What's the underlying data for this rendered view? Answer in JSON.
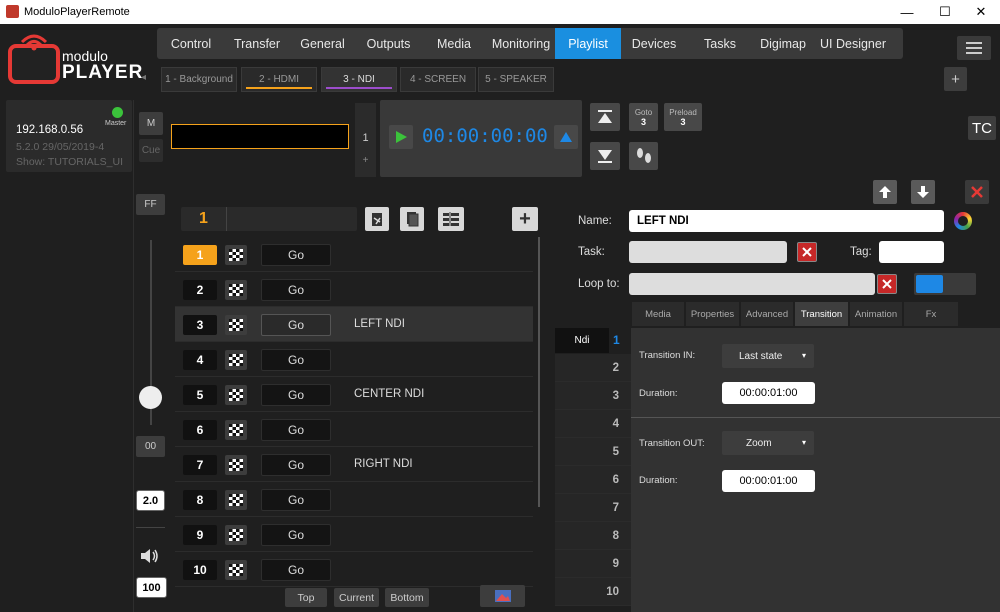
{
  "window": {
    "title": "ModuloPlayerRemote",
    "minimize": "—",
    "maximize": "☐",
    "close": "✕"
  },
  "logo": {
    "brand_top": "modulo",
    "brand_bottom": "PLAYER"
  },
  "nav": {
    "items": [
      "Control",
      "Transfer",
      "General",
      "Outputs",
      "Media",
      "Monitoring",
      "Playlist",
      "Devices",
      "Tasks",
      "Digimap",
      "UI Designer"
    ],
    "active": "Playlist"
  },
  "layer_tabs": {
    "items": [
      "1 - Background",
      "2 - HDMI",
      "3 - NDI",
      "4 - SCREEN",
      "5 - SPEAKER"
    ],
    "active": "3 - NDI",
    "add_label": "+",
    "left_arrow": "◂"
  },
  "server": {
    "ip": "192.168.0.56",
    "status": "Master",
    "version": "5.2.0 29/05/2019-4",
    "show": "Show: TUTORIALS_UI"
  },
  "left": {
    "m_label": "M",
    "cue_label": "Cue",
    "ff_label": "FF",
    "zero_label": "00",
    "speed_value": "2.0",
    "volume_value": "100"
  },
  "transport": {
    "cue_index": "1",
    "plus": "+",
    "timecode": "00:00:00:00"
  },
  "goto": {
    "label": "Goto",
    "value": "3"
  },
  "preload": {
    "label": "Preload",
    "value": "3"
  },
  "tc_label": "TC",
  "playlist": {
    "current_cue": "1",
    "add_label": "+",
    "rows": [
      {
        "num": "1",
        "go": "Go",
        "label": ""
      },
      {
        "num": "2",
        "go": "Go",
        "label": ""
      },
      {
        "num": "3",
        "go": "Go",
        "label": "LEFT NDI"
      },
      {
        "num": "4",
        "go": "Go",
        "label": ""
      },
      {
        "num": "5",
        "go": "Go",
        "label": "CENTER NDI"
      },
      {
        "num": "6",
        "go": "Go",
        "label": ""
      },
      {
        "num": "7",
        "go": "Go",
        "label": "RIGHT NDI"
      },
      {
        "num": "8",
        "go": "Go",
        "label": ""
      },
      {
        "num": "9",
        "go": "Go",
        "label": ""
      },
      {
        "num": "10",
        "go": "Go",
        "label": ""
      }
    ],
    "bottom_buttons": [
      "Top",
      "Current",
      "Bottom"
    ]
  },
  "properties": {
    "name_label": "Name:",
    "name_value": "LEFT NDI",
    "task_label": "Task:",
    "task_value": "",
    "tag_label": "Tag:",
    "tag_value": "",
    "loop_label": "Loop to:",
    "loop_value": ""
  },
  "prop_tabs": {
    "items": [
      "Media",
      "Properties",
      "Advanced",
      "Transition",
      "Animation",
      "Fx"
    ],
    "active": "Transition"
  },
  "ndi_column": {
    "header": "Ndi",
    "cells": [
      "1",
      "2",
      "3",
      "4",
      "5",
      "6",
      "7",
      "8",
      "9",
      "10"
    ]
  },
  "transition": {
    "in_label": "Transition IN:",
    "in_value": "Last state",
    "in_duration_label": "Duration:",
    "in_duration": "00:00:01:00",
    "out_label": "Transition OUT:",
    "out_value": "Zoom",
    "out_duration_label": "Duration:",
    "out_duration": "00:00:01:00"
  },
  "colors": {
    "accent": "#1a8fe0",
    "orange": "#f5a21b",
    "red": "#c62828",
    "timecode": "#1e88e5"
  }
}
